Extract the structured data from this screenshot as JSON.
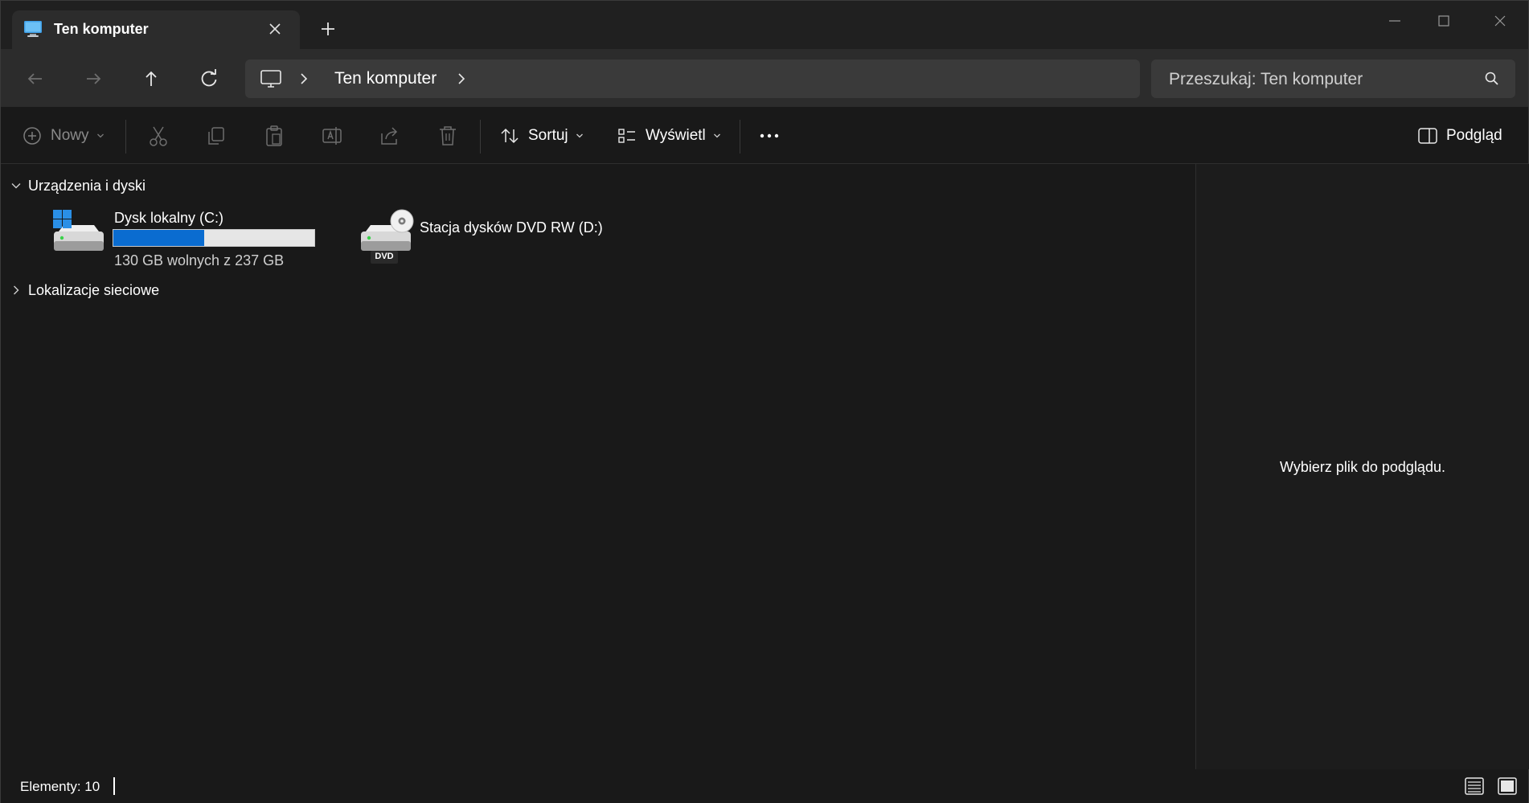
{
  "tab": {
    "title": "Ten komputer",
    "icon": "computer-icon"
  },
  "address": {
    "location": "Ten komputer"
  },
  "search": {
    "placeholder": "Przeszukaj: Ten komputer"
  },
  "toolbar": {
    "new_label": "Nowy",
    "sort_label": "Sortuj",
    "view_label": "Wyświetl",
    "preview_label": "Podgląd"
  },
  "sections": {
    "devices": "Urządzenia i dyski",
    "network": "Lokalizacje sieciowe"
  },
  "drives": [
    {
      "name": "Dysk lokalny (C:)",
      "free_text": "130 GB wolnych z 237 GB",
      "used_fraction": 0.45
    },
    {
      "name": "Stacja dysków DVD RW (D:)",
      "badge": "DVD"
    }
  ],
  "preview": {
    "message": "Wybierz plik do podglądu."
  },
  "status": {
    "items": "Elementy: 10"
  },
  "colors": {
    "accent": "#0a6cd0",
    "background": "#191919"
  }
}
